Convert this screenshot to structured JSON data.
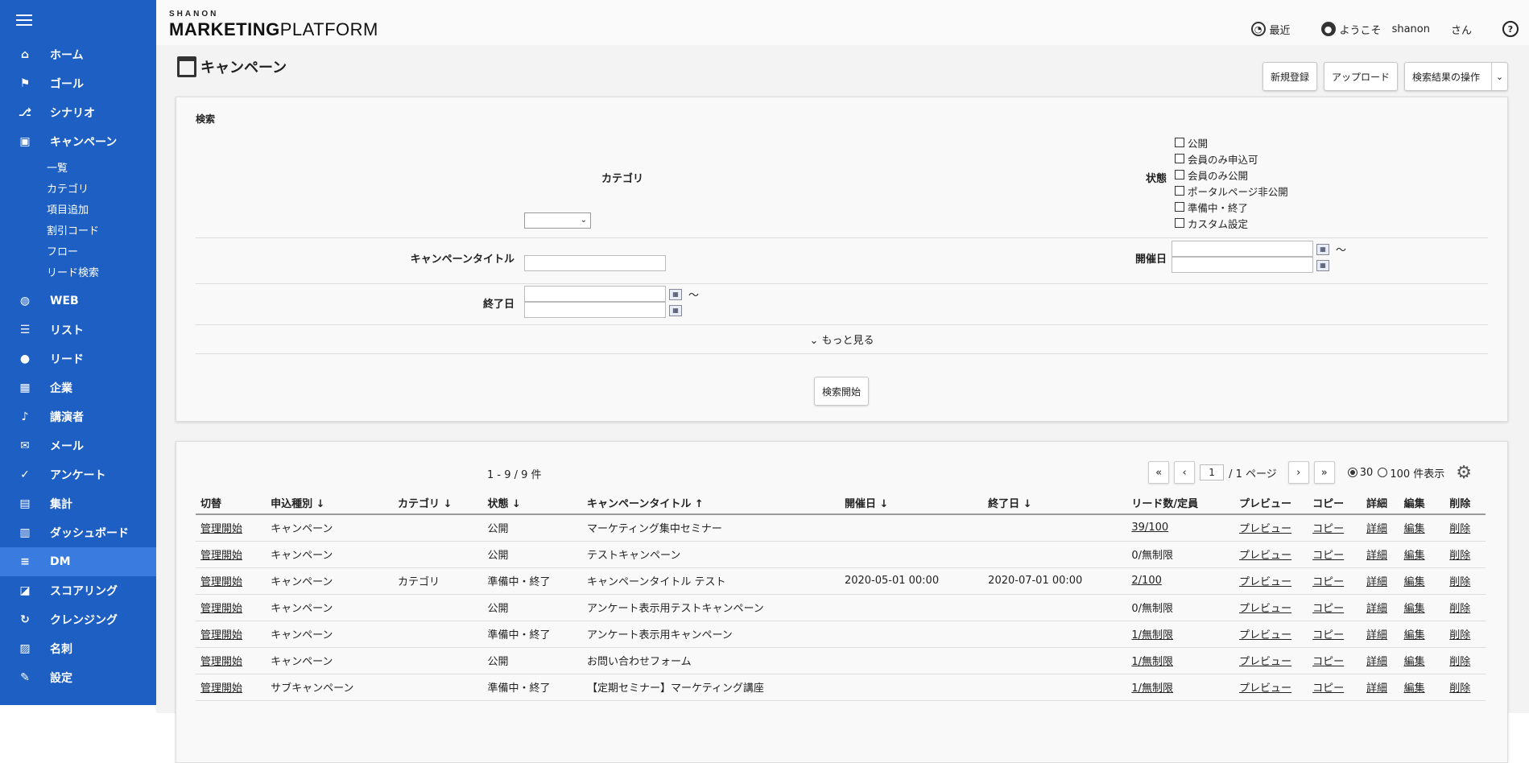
{
  "sidebar": {
    "items": [
      {
        "label": "ホーム",
        "icon": "home-icon",
        "glyph": "⌂"
      },
      {
        "label": "ゴール",
        "icon": "flag-icon",
        "glyph": "⚑"
      },
      {
        "label": "シナリオ",
        "icon": "scenario-icon",
        "glyph": "⎇"
      },
      {
        "label": "キャンペーン",
        "icon": "calendar-icon",
        "glyph": "▣"
      }
    ],
    "sub_items": [
      "一覧",
      "カテゴリ",
      "項目追加",
      "割引コード",
      "フロー",
      "リード検索"
    ],
    "items2": [
      {
        "label": "WEB",
        "icon": "globe-icon",
        "glyph": "◍"
      },
      {
        "label": "リスト",
        "icon": "list-icon",
        "glyph": "☰"
      },
      {
        "label": "リード",
        "icon": "person-icon",
        "glyph": "●"
      },
      {
        "label": "企業",
        "icon": "building-icon",
        "glyph": "▦"
      },
      {
        "label": "講演者",
        "icon": "mic-icon",
        "glyph": "♪"
      },
      {
        "label": "メール",
        "icon": "mail-icon",
        "glyph": "✉"
      },
      {
        "label": "アンケート",
        "icon": "check-icon",
        "glyph": "✓"
      },
      {
        "label": "集計",
        "icon": "report-icon",
        "glyph": "▤"
      },
      {
        "label": "ダッシュボード",
        "icon": "bar-chart-icon",
        "glyph": "▥"
      },
      {
        "label": "DM",
        "icon": "dm-icon",
        "glyph": "≡"
      },
      {
        "label": "スコアリング",
        "icon": "scoring-icon",
        "glyph": "◪"
      },
      {
        "label": "クレンジング",
        "icon": "cleansing-icon",
        "glyph": "↻"
      },
      {
        "label": "名刺",
        "icon": "card-icon",
        "glyph": "▨"
      },
      {
        "label": "設定",
        "icon": "wrench-icon",
        "glyph": "✎"
      }
    ]
  },
  "header": {
    "logo_top": "SHANON",
    "logo_a": "M",
    "logo_b": "ARKETING",
    "logo_c": "P",
    "logo_d": "LATFORM",
    "recent": "最近",
    "welcome": "ようこそ",
    "user": "shanon",
    "honorific": "さん",
    "help": "?"
  },
  "page": {
    "title": "キャンペーン",
    "btn_new": "新規登録",
    "btn_upload": "アップロード",
    "btn_ops": "検索結果の操作",
    "caret": "⌄"
  },
  "search": {
    "title": "検索",
    "category_label": "カテゴリ",
    "status_label": "状態",
    "status_options": [
      "公開",
      "会員のみ申込可",
      "会員のみ公開",
      "ポータルページ非公開",
      "準備中・終了",
      "カスタム設定"
    ],
    "title_label": "キャンペーンタイトル",
    "start_label": "開催日",
    "end_label": "終了日",
    "tilde": "〜",
    "more": "⌄ もっと見る",
    "submit": "検索開始",
    "cal": "▦"
  },
  "results": {
    "count": "1 - 9 / 9 件",
    "first": "«",
    "prev": "‹",
    "page": "1",
    "page_total": "/ 1 ページ",
    "next": "›",
    "last": "»",
    "per30": "30",
    "per100": "100 件表示",
    "gear": "⚙",
    "columns": [
      "切替",
      "申込種別 ↓",
      "カテゴリ ↓",
      "状態 ↓",
      "キャンペーンタイトル ↑",
      "開催日 ↓",
      "終了日 ↓",
      "リード数/定員",
      "プレビュー",
      "コピー",
      "詳細",
      "編集",
      "削除"
    ],
    "rows": [
      {
        "switch": "管理開始",
        "type": "キャンペーン",
        "category": "",
        "status": "公開",
        "title": "マーケティング集中セミナー",
        "start": "",
        "end": "",
        "leads": "39/100",
        "leads_link": true,
        "preview": "プレビュー",
        "copy": "コピー",
        "detail": "詳細",
        "edit": "編集",
        "del": "削除"
      },
      {
        "switch": "管理開始",
        "type": "キャンペーン",
        "category": "",
        "status": "公開",
        "title": "テストキャンペーン",
        "start": "",
        "end": "",
        "leads": "0/無制限",
        "leads_link": false,
        "preview": "プレビュー",
        "copy": "コピー",
        "detail": "詳細",
        "edit": "編集",
        "del": "削除"
      },
      {
        "switch": "管理開始",
        "type": "キャンペーン",
        "category": "カテゴリ",
        "status": "準備中・終了",
        "title": "キャンペーンタイトル テスト",
        "start": "2020-05-01 00:00",
        "end": "2020-07-01 00:00",
        "leads": "2/100",
        "leads_link": true,
        "preview": "プレビュー",
        "copy": "コピー",
        "detail": "詳細",
        "edit": "編集",
        "del": "削除"
      },
      {
        "switch": "管理開始",
        "type": "キャンペーン",
        "category": "",
        "status": "公開",
        "title": "アンケート表示用テストキャンペーン",
        "start": "",
        "end": "",
        "leads": "0/無制限",
        "leads_link": false,
        "preview": "プレビュー",
        "copy": "コピー",
        "detail": "詳細",
        "edit": "編集",
        "del": "削除"
      },
      {
        "switch": "管理開始",
        "type": "キャンペーン",
        "category": "",
        "status": "準備中・終了",
        "title": "アンケート表示用キャンペーン",
        "start": "",
        "end": "",
        "leads": "1/無制限",
        "leads_link": true,
        "preview": "プレビュー",
        "copy": "コピー",
        "detail": "詳細",
        "edit": "編集",
        "del": "削除"
      },
      {
        "switch": "管理開始",
        "type": "キャンペーン",
        "category": "",
        "status": "公開",
        "title": "お問い合わせフォーム",
        "start": "",
        "end": "",
        "leads": "1/無制限",
        "leads_link": true,
        "preview": "プレビュー",
        "copy": "コピー",
        "detail": "詳細",
        "edit": "編集",
        "del": "削除"
      },
      {
        "switch": "管理開始",
        "type": "サブキャンペーン",
        "category": "",
        "status": "準備中・終了",
        "title": "【定期セミナー】マーケティング講座",
        "start": "",
        "end": "",
        "leads": "1/無制限",
        "leads_link": true,
        "preview": "プレビュー",
        "copy": "コピー",
        "detail": "詳細",
        "edit": "編集",
        "del": "削除"
      }
    ]
  }
}
